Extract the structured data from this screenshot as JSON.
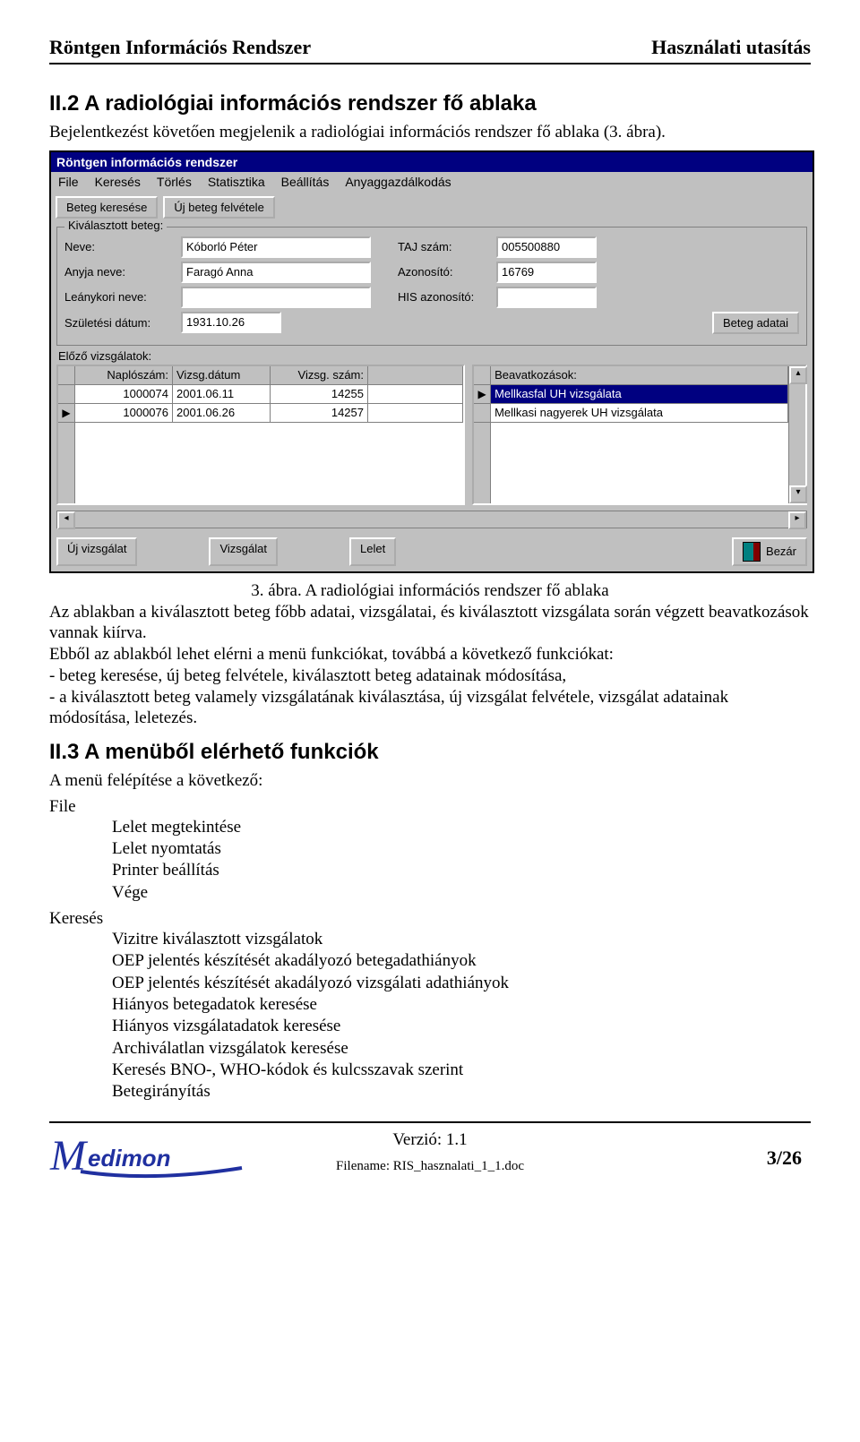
{
  "header": {
    "left": "Röntgen Információs Rendszer",
    "right": "Használati utasítás"
  },
  "sec2": {
    "title": "II.2 A radiológiai információs rendszer fő ablaka",
    "intro": "Bejelentkezést követően megjelenik a radiológiai információs rendszer fő ablaka (3. ábra)."
  },
  "win": {
    "title": "Röntgen információs rendszer",
    "menus": [
      "File",
      "Keresés",
      "Törlés",
      "Statisztika",
      "Beállítás",
      "Anyaggazdálkodás"
    ],
    "toolbar": {
      "search": "Beteg keresése",
      "new": "Új beteg felvétele"
    },
    "group_legend": "Kiválasztott beteg:",
    "labels": {
      "neve": "Neve:",
      "taj": "TAJ szám:",
      "anyja": "Anyja neve:",
      "azon": "Azonosító:",
      "leany": "Leánykori neve:",
      "his": "HIS azonosító:",
      "szul": "Születési dátum:",
      "beteg_adatai": "Beteg adatai",
      "elozo": "Előző vizsgálatok:"
    },
    "fields": {
      "neve": "Kóborló Péter",
      "taj": "005500880",
      "anyja": "Faragó Anna",
      "azon": "16769",
      "leany": "",
      "his": "",
      "szul": "1931.10.26"
    },
    "left_table": {
      "headers": [
        "Naplószám:",
        "Vizsg.dátum",
        "Vizsg. szám:"
      ],
      "rows": [
        [
          "1000074",
          "2001.06.11",
          "14255"
        ],
        [
          "1000076",
          "2001.06.26",
          "14257"
        ]
      ]
    },
    "right_table": {
      "header": "Beavatkozások:",
      "rows": [
        "Mellkasfal UH vizsgálata",
        "Mellkasi nagyerek UH vizsgálata"
      ],
      "selected": 0
    },
    "bottom": {
      "uj": "Új vizsgálat",
      "viz": "Vizsgálat",
      "lelet": "Lelet",
      "bezar": "Bezár"
    }
  },
  "fig_caption": "3. ábra. A radiológiai információs rendszer fő ablaka",
  "para_after": "Az ablakban a kiválasztott beteg főbb adatai, vizsgálatai, és kiválasztott vizsgálata során végzett beavatkozások vannak kiírva.",
  "para2": "Ebből az ablakból lehet elérni a menü funkciókat, továbbá a következő funkciókat:",
  "bullets": [
    "- beteg keresése, új beteg felvétele, kiválasztott beteg adatainak módosítása,",
    "- a kiválasztott beteg valamely vizsgálatának kiválasztása, új vizsgálat felvétele, vizsgálat adatainak módosítása, leletezés."
  ],
  "sec3": {
    "title": "II.3 A menüből elérhető  funkciók",
    "intro": "A menü felépítése a következő:"
  },
  "menu_file": {
    "head": "File",
    "items": [
      "Lelet megtekintése",
      "Lelet nyomtatás",
      "Printer beállítás",
      "Vége"
    ]
  },
  "menu_kereses": {
    "head": "Keresés",
    "items": [
      "Vizitre kiválasztott vizsgálatok",
      "OEP jelentés készítését akadályozó betegadathiányok",
      "OEP jelentés készítését akadályozó vizsgálati adathiányok",
      "Hiányos betegadatok keresése",
      "Hiányos vizsgálatadatok keresése",
      "Archiválatlan vizsgálatok keresése",
      "Keresés BNO-, WHO-kódok és kulcsszavak szerint",
      "Betegirányítás"
    ]
  },
  "footer": {
    "verzio": "Verzió: 1.1",
    "filename": "Filename: RIS_hasznalati_1_1.doc",
    "page": "3/26",
    "logo": "Medimon"
  }
}
